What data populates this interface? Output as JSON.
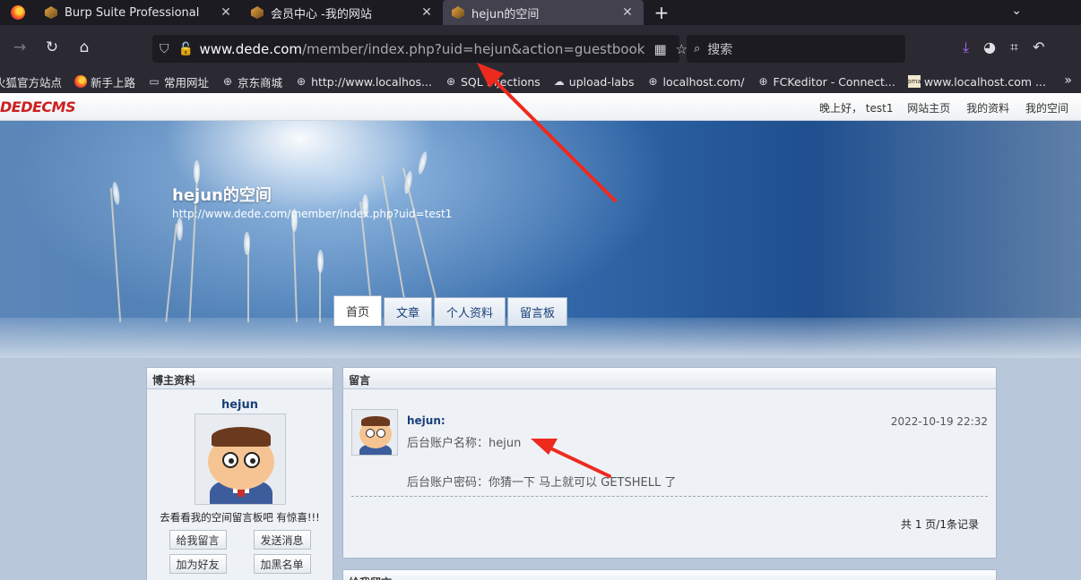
{
  "browser": {
    "tabs": [
      {
        "label": "Burp Suite Professional",
        "active": false
      },
      {
        "label": "会员中心 -我的网站",
        "active": false
      },
      {
        "label": "hejun的空间",
        "active": true
      }
    ],
    "url": {
      "host": "www.dede.com",
      "path": "/member/index.php?uid=hejun&action=guestbook"
    },
    "search_placeholder": "搜索",
    "bookmarks": [
      {
        "label": "火狐官方站点",
        "icon": "firefox-icon"
      },
      {
        "label": "新手上路",
        "icon": "firefox-icon"
      },
      {
        "label": "常用网址",
        "icon": "folder-icon"
      },
      {
        "label": "京东商城",
        "icon": "globe-icon"
      },
      {
        "label": "http://www.localhos...",
        "icon": "globe-icon"
      },
      {
        "label": "SQL Injections",
        "icon": "globe-icon"
      },
      {
        "label": "upload-labs",
        "icon": "upload-icon"
      },
      {
        "label": "localhost.com/",
        "icon": "globe-icon"
      },
      {
        "label": "FCKeditor - Connect...",
        "icon": "globe-icon"
      },
      {
        "label": "www.localhost.com ...",
        "icon": "phpmyadmin-icon"
      }
    ]
  },
  "site": {
    "logo": "DEDECMS",
    "greeting": "晚上好，  test1",
    "nav": [
      "网站主页",
      "我的资料",
      "我的空间"
    ],
    "space_title": "hejun的空间",
    "space_url": "http://www.dede.com/member/index.php?uid=test1",
    "tabs": [
      "首页",
      "文章",
      "个人资料",
      "留言板"
    ],
    "owner_panel": {
      "title": "博主资料",
      "name": "hejun",
      "note": "去看看我的空间留言板吧 有惊喜!!!",
      "buttons": [
        "给我留言",
        "发送消息",
        "加为好友",
        "加黑名单"
      ]
    },
    "messages_panel": {
      "title": "留言",
      "author": "hejun:",
      "time": "2022-10-19 22:32",
      "line1": "后台账户名称：hejun",
      "line2": "后台账户密码：你猜一下 马上就可以 GETSHELL 了",
      "pager": "共 1 页/1条记录"
    },
    "give_panel_title": "给我留言"
  },
  "colors": {
    "annotation_arrow": "#ee2a1f",
    "link_blue": "#1a3f78"
  }
}
